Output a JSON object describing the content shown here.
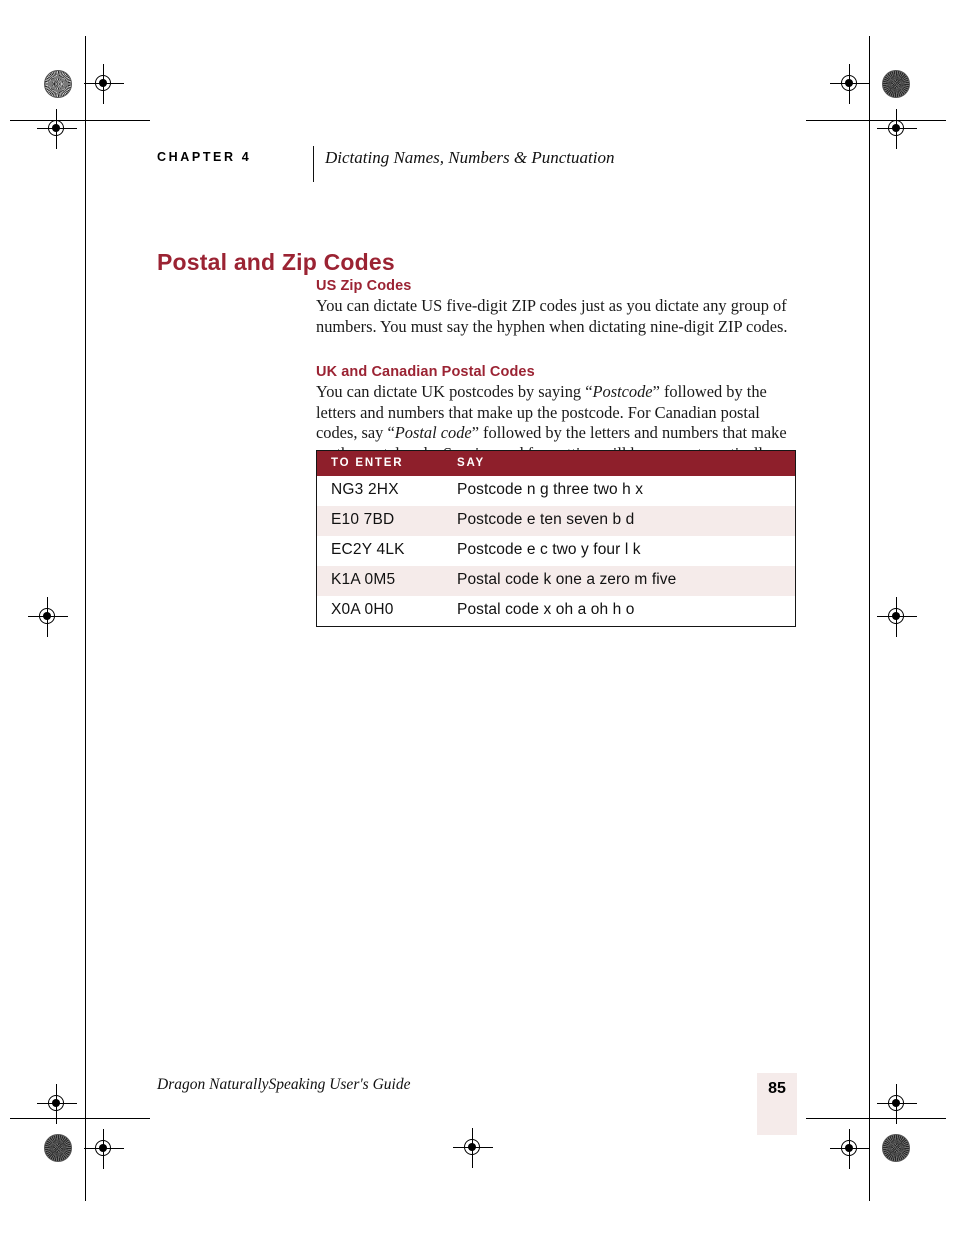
{
  "page": {
    "number": "85",
    "footer_title": "Dragon NaturallySpeaking User's Guide"
  },
  "running_head": {
    "chapter_label": "CHAPTER 4",
    "chapter_title": "Dictating Names, Numbers & Punctuation"
  },
  "section": {
    "title": "Postal and Zip Codes"
  },
  "subsections": [
    {
      "title": "US Zip Codes",
      "paragraph": "You can dictate US five-digit ZIP codes just as you dictate any group of numbers. You must say the hyphen when dictating nine-digit ZIP codes."
    },
    {
      "title": "UK and Canadian Postal Codes",
      "paragraph_part1": "You can dictate UK postcodes by saying “",
      "paragraph_italic1": "Postcode",
      "paragraph_part2": "” followed by the letters and numbers that make up the postcode. For Canadian postal codes, say “",
      "paragraph_italic2": "Postal code",
      "paragraph_part3": "” followed by the letters and numbers that make up the postal code. Spacing and formatting will happen automatically."
    }
  ],
  "table": {
    "headers": [
      "TO ENTER",
      "SAY"
    ],
    "rows": [
      {
        "to_enter": "NG3 2HX",
        "say": "Postcode n g three two h x"
      },
      {
        "to_enter": "E10 7BD",
        "say": "Postcode e ten seven b d"
      },
      {
        "to_enter": "EC2Y 4LK",
        "say": "Postcode e c two y four l k"
      },
      {
        "to_enter": "K1A 0M5",
        "say": "Postal code k one a zero m five"
      },
      {
        "to_enter": "X0A 0H0",
        "say": "Postal code x oh a oh h o"
      }
    ]
  },
  "colors": {
    "heading_red": "#9B2333",
    "table_header_red": "#8E1F2B",
    "row_tint": "#F5EBEA"
  }
}
